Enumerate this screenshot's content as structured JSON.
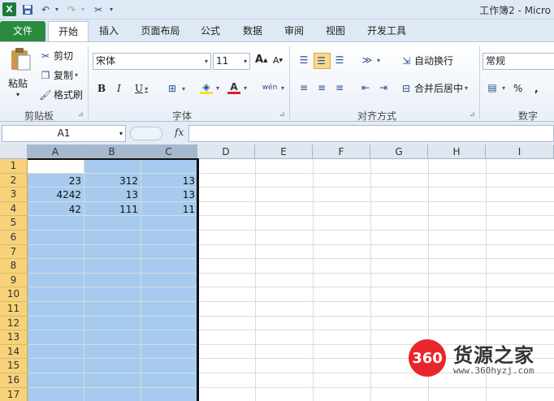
{
  "titlebar": {
    "title": "工作簿2 - Micro",
    "app_logo": "X",
    "icons": [
      "excel-logo",
      "save-icon",
      "undo-icon",
      "redo-icon",
      "custom-qat-icon"
    ]
  },
  "tabs": [
    {
      "label": "文件"
    },
    {
      "label": "开始"
    },
    {
      "label": "插入"
    },
    {
      "label": "页面布局"
    },
    {
      "label": "公式"
    },
    {
      "label": "数据"
    },
    {
      "label": "审阅"
    },
    {
      "label": "视图"
    },
    {
      "label": "开发工具"
    }
  ],
  "ribbon": {
    "clipboard": {
      "paste": "粘贴",
      "cut": "剪切",
      "copy": "复制",
      "format_painter": "格式刷",
      "group": "剪贴板"
    },
    "font": {
      "font_name": "宋体",
      "font_size": "11",
      "grow": "A",
      "shrink": "A",
      "bold": "B",
      "italic": "I",
      "underline": "U",
      "phonetic": "wén",
      "group": "字体"
    },
    "alignment": {
      "wrap_text": "自动换行",
      "merge_center": "合并后居中",
      "group": "对齐方式"
    },
    "number": {
      "format": "常规",
      "percent": "%",
      "comma": ",",
      "group": "数字"
    }
  },
  "formula_bar": {
    "name_box": "A1",
    "fx": "fx",
    "value": ""
  },
  "sheet": {
    "columns": [
      "A",
      "B",
      "C",
      "D",
      "E",
      "F",
      "G",
      "H",
      "I"
    ],
    "rows": [
      "1",
      "2",
      "3",
      "4",
      "5",
      "6",
      "7",
      "8",
      "9",
      "10",
      "11",
      "12",
      "13",
      "14",
      "15",
      "16",
      "17"
    ],
    "cells": {
      "A2": "23",
      "B2": "312",
      "C2": "13",
      "A3": "4242",
      "B3": "13",
      "C3": "13",
      "A4": "42",
      "B4": "111",
      "C4": "11"
    },
    "selection": "A1:C17",
    "active_cell": "A1"
  },
  "watermark": {
    "logo": "360",
    "brand": "货源之家",
    "url": "www.360hyzj.com"
  },
  "colors": {
    "file_tab": "#2a8a3e",
    "selection_fill": "#a6cbef",
    "row_header_selected": "#f8d27a",
    "watermark_red": "#e8262c"
  }
}
